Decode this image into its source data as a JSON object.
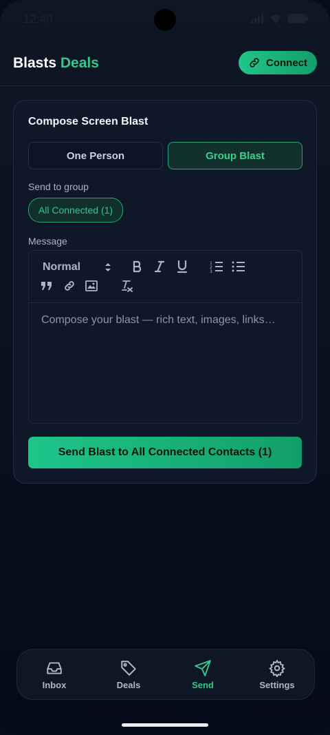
{
  "status_bar": {
    "time": "12:40"
  },
  "header": {
    "brand_part1": "Blasts",
    "brand_part2": "Deals",
    "connect_label": "Connect",
    "connect_icon": "link-icon"
  },
  "compose": {
    "title": "Compose Screen Blast",
    "mode_options": [
      "One Person",
      "Group Blast"
    ],
    "selected_mode": "Group Blast",
    "send_to_label": "Send to group",
    "group_chip": "All Connected (1)",
    "message_label": "Message",
    "format_select": "Normal",
    "toolbar_icons": [
      "bold-icon",
      "italic-icon",
      "underline-icon",
      "ordered-list-icon",
      "bullet-list-icon",
      "blockquote-icon",
      "link-icon",
      "image-icon",
      "clear-format-icon"
    ],
    "placeholder": "Compose your blast — rich text, images, links…",
    "send_button": "Send Blast to All Connected Contacts (1)"
  },
  "tabs": [
    {
      "label": "Inbox",
      "icon": "inbox-icon"
    },
    {
      "label": "Deals",
      "icon": "tag-icon"
    },
    {
      "label": "Send",
      "icon": "send-icon",
      "active": true
    },
    {
      "label": "Settings",
      "icon": "gear-icon"
    }
  ],
  "colors": {
    "accent": "#2fc98a",
    "background": "#0b1222",
    "card": "#0f1828"
  }
}
